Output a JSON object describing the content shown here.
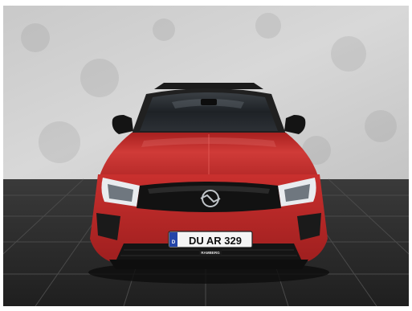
{
  "photo": {
    "subject": "car-front",
    "license_plate": {
      "country_code": "D",
      "text": "DU AR 329"
    },
    "dealer_plate_text": "RAMBERG",
    "colors": {
      "body": "#c8302f",
      "wall": "#d2d2d2",
      "floor": "#2a2a2a",
      "grille": "#121212"
    }
  }
}
